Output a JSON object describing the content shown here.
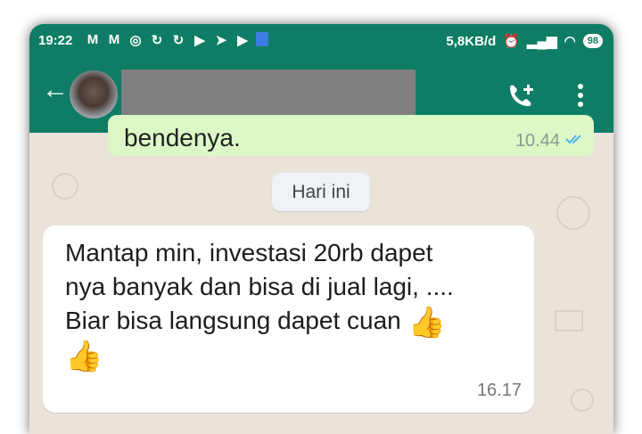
{
  "status_bar": {
    "time": "19:22",
    "speed": "5,8KB/d",
    "battery": "98",
    "notification_icons": [
      "gmail-icon",
      "gmail-icon",
      "instagram-icon",
      "sync-icon",
      "sync-icon",
      "play-icon",
      "telegram-icon",
      "play-icon",
      "app-icon"
    ]
  },
  "app_bar": {
    "contact_name": ""
  },
  "chat": {
    "previous_message": {
      "text": "bendenya.",
      "time": "10.44"
    },
    "date_separator": "Hari ini",
    "message": {
      "line1": "Mantap min, investasi 20rb dapet",
      "line2": "nya banyak dan bisa di jual lagi, ....",
      "line3": "Biar bisa langsung dapet cuan",
      "emoji": "👍",
      "time": "16.17"
    }
  },
  "colors": {
    "header": "#0f7d65",
    "chat_bg": "#e9e3da",
    "outgoing_bubble": "#dcf8c6",
    "incoming_bubble": "#ffffff",
    "date_chip": "#eef3f8"
  }
}
